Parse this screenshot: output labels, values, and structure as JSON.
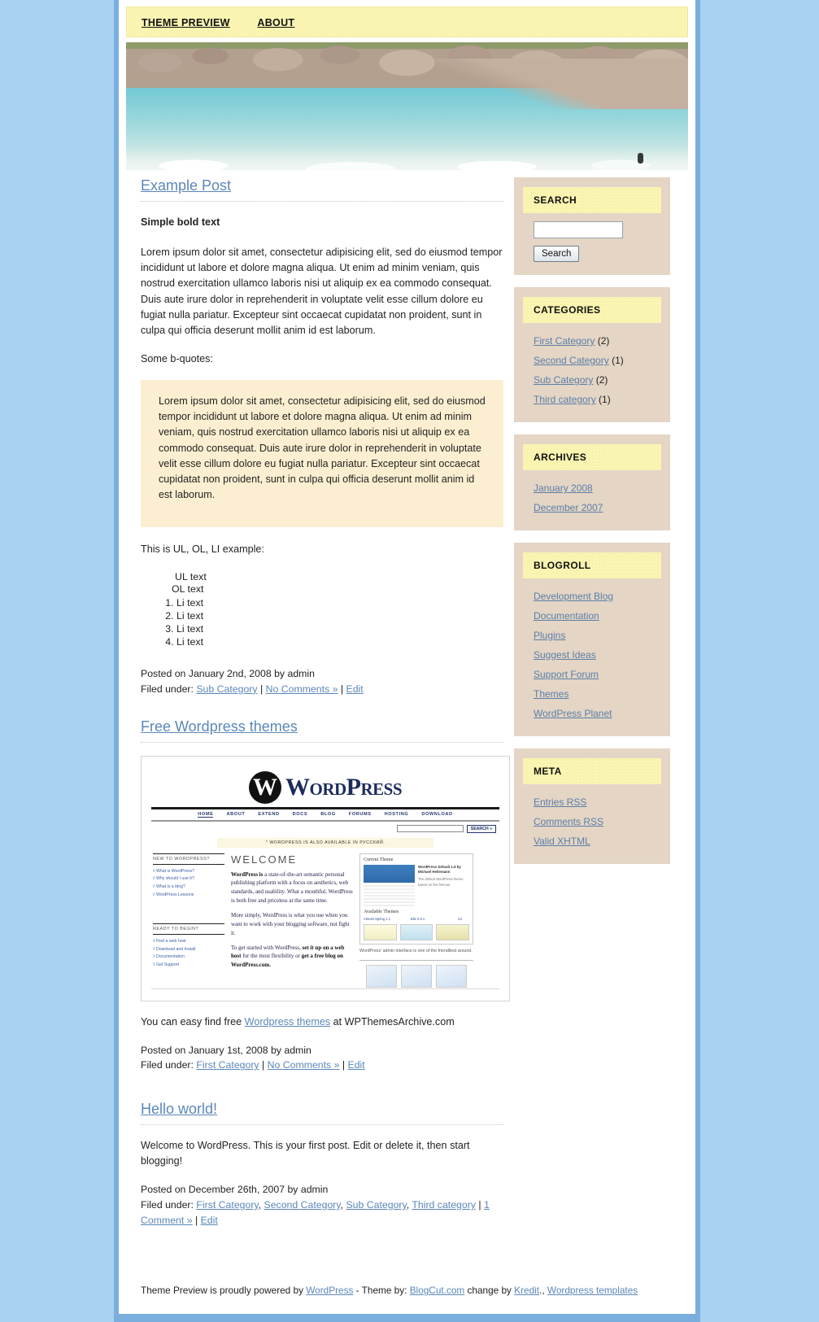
{
  "nav": {
    "items": [
      {
        "label": "Theme Preview"
      },
      {
        "label": "About"
      }
    ]
  },
  "posts": [
    {
      "title": "Example Post",
      "bold_line": "Simple bold text",
      "paragraph": "Lorem ipsum dolor sit amet, consectetur adipisicing elit, sed do eiusmod tempor incididunt ut labore et dolore magna aliqua. Ut enim ad minim veniam, quis nostrud exercitation ullamco laboris nisi ut aliquip ex ea commodo consequat. Duis aute irure dolor in reprehenderit in voluptate velit esse cillum dolore eu fugiat nulla pariatur. Excepteur sint occaecat cupidatat non proident, sunt in culpa qui officia deserunt mollit anim id est laborum.",
      "quote_intro": "Some b-quotes:",
      "blockquote": "Lorem ipsum dolor sit amet, consectetur adipisicing elit, sed do eiusmod tempor incididunt ut labore et dolore magna aliqua. Ut enim ad minim veniam, quis nostrud exercitation ullamco laboris nisi ut aliquip ex ea commodo consequat. Duis aute irure dolor in reprehenderit in voluptate velit esse cillum dolore eu fugiat nulla pariatur. Excepteur sint occaecat cupidatat non proident, sunt in culpa qui officia deserunt mollit anim id est laborum.",
      "list_intro": "This is UL, OL, LI example:",
      "ul_text": "UL text",
      "ol_text": "OL text",
      "li_items": [
        "Li text",
        "Li text",
        "Li text",
        "Li text"
      ],
      "posted": "Posted on January 2nd, 2008 by admin",
      "filed_label": "Filed under:",
      "categories": [
        "Sub Category"
      ],
      "comments_link": "No Comments »",
      "edit_link": "Edit"
    },
    {
      "title": "Free Wordpress themes",
      "caption_before": "You can easy find free ",
      "caption_link": "Wordpress themes",
      "caption_after": " at WPThemesArchive.com",
      "posted": "Posted on January 1st, 2008 by admin",
      "filed_label": "Filed under:",
      "categories": [
        "First Category"
      ],
      "comments_link": "No Comments »",
      "edit_link": "Edit"
    },
    {
      "title": "Hello world!",
      "paragraph": "Welcome to WordPress. This is your first post. Edit or delete it, then start blogging!",
      "posted": "Posted on December 26th, 2007 by admin",
      "filed_label": "Filed under:",
      "categories": [
        "First Category",
        "Second Category",
        "Sub Category",
        "Third category"
      ],
      "comments_link": "1 Comment »",
      "edit_link": "Edit"
    }
  ],
  "screenshot": {
    "logo_mark": "W",
    "logo_text": "WordPress",
    "nav": [
      "HOME",
      "ABOUT",
      "EXTEND",
      "DOCS",
      "BLOG",
      "FORUMS",
      "HOSTING",
      "DOWNLOAD"
    ],
    "search_button": "SEARCH »",
    "banner": "° WORDPRESS IS ALSO AVAILABLE IN РУССКИЙ.",
    "welcome": "WELCOME",
    "left_head_1": "NEW TO WORDPRESS?",
    "left_links_1": [
      "◊ What is WordPress?",
      "◊ Why should I use it?",
      "◊ What is a blog?",
      "◊ WordPress Lessons"
    ],
    "left_head_2": "READY TO BEGIN?",
    "left_links_2": [
      "◊ Find a web host",
      "◊ Download and Install",
      "◊ Documentation",
      "◊ Get Support"
    ],
    "para_1_bold": "WordPress is",
    "para_1": " a state-of-the-art semantic personal publishing platform with a focus on aesthetics, web standards, and usability. What a mouthful. WordPress is both free and priceless at the same time.",
    "para_2": "More simply, WordPress is what you use when you want to work with your blogging software, not fight it.",
    "para_3_pre": "To get started with WordPress, ",
    "para_3_b1": "set it up on a web host",
    "para_3_mid": " for the most flexibility or ",
    "para_3_b2": "get a free blog on WordPress.com.",
    "panel_title": "Current Theme",
    "panel_sub": "WordPress Default 1.6 by Michael Heilemann",
    "panel_note": "The default WordPress theme based on the famous",
    "available_title": "Available Themes",
    "theme_names": [
      "Almost Spring 1.1",
      "Blix 0.9.1",
      "Co"
    ],
    "admin_caption": "WordPress' admin interface is one of the friendliest around."
  },
  "sidebar": {
    "widgets": [
      {
        "title": "Search",
        "type": "search",
        "input_value": "",
        "button_label": "Search"
      },
      {
        "title": "Categories",
        "type": "links",
        "items": [
          {
            "label": "First Category",
            "count": "(2)"
          },
          {
            "label": "Second Category",
            "count": "(1)"
          },
          {
            "label": "Sub Category",
            "count": "(2)"
          },
          {
            "label": "Third category",
            "count": "(1)"
          }
        ]
      },
      {
        "title": "Archives",
        "type": "links",
        "items": [
          {
            "label": "January 2008",
            "count": ""
          },
          {
            "label": "December 2007",
            "count": ""
          }
        ]
      },
      {
        "title": "Blogroll",
        "type": "links",
        "items": [
          {
            "label": "Development Blog",
            "count": ""
          },
          {
            "label": "Documentation",
            "count": ""
          },
          {
            "label": "Plugins",
            "count": ""
          },
          {
            "label": "Suggest Ideas",
            "count": ""
          },
          {
            "label": "Support Forum",
            "count": ""
          },
          {
            "label": "Themes",
            "count": ""
          },
          {
            "label": "WordPress Planet",
            "count": ""
          }
        ]
      },
      {
        "title": "Meta",
        "type": "links",
        "items": [
          {
            "label": "Entries RSS",
            "count": ""
          },
          {
            "label": "Comments RSS",
            "count": ""
          },
          {
            "label": "Valid XHTML",
            "count": ""
          }
        ]
      }
    ]
  },
  "footer": {
    "pre": "Theme Preview is proudly powered by ",
    "link1": "WordPress",
    "mid1": " - Theme by: ",
    "link2": "BlogCut.com",
    "mid2": " change by ",
    "link3": "Kredit",
    "mid3": "., ",
    "link4": "Wordpress templates"
  },
  "colors": {
    "page_bg": "#a7d2f2",
    "frame_border": "#7aaedd",
    "nav_yellow": "#fbf5b4",
    "widget_bg": "#e4d5c5",
    "quote_bg": "#fcefd1",
    "link_blue": "#5b87b8"
  }
}
